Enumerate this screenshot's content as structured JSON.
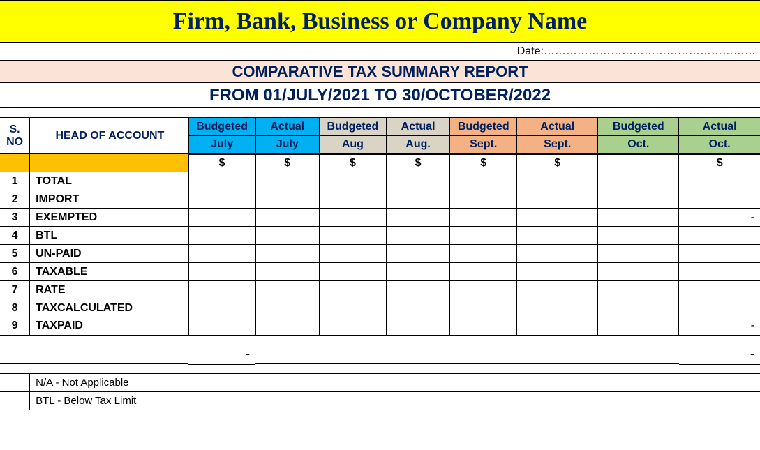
{
  "title": "Firm, Bank, Business or Company  Name",
  "date_label": "Date:…………………………………………………",
  "report_title": "COMPARATIVE TAX  SUMMARY REPORT",
  "period": "FROM 01/JULY/2021  TO 30/OCTOBER/2022",
  "headers": {
    "sno": "S. NO",
    "hoa": "HEAD OF ACCOUNT",
    "cols": [
      {
        "top": "Budgeted",
        "bot": "July"
      },
      {
        "top": "Actual",
        "bot": "July"
      },
      {
        "top": "Budgeted",
        "bot": "Aug"
      },
      {
        "top": "Actual",
        "bot": "Aug."
      },
      {
        "top": "Budgeted",
        "bot": "Sept."
      },
      {
        "top": "Actual",
        "bot": "Sept."
      },
      {
        "top": "Budgeted",
        "bot": "Oct."
      },
      {
        "top": "Actual",
        "bot": "Oct."
      }
    ]
  },
  "currency": "$",
  "rows": [
    {
      "n": "1",
      "label": " TOTAL",
      "vals": [
        "",
        "",
        "",
        "",
        "",
        "",
        "",
        ""
      ]
    },
    {
      "n": "2",
      "label": "IMPORT",
      "vals": [
        "",
        "",
        "",
        "",
        "",
        "",
        "",
        ""
      ]
    },
    {
      "n": "3",
      "label": "EXEMPTED",
      "vals": [
        "",
        "",
        "",
        "",
        "",
        "",
        "",
        "-"
      ]
    },
    {
      "n": "4",
      "label": "BTL",
      "vals": [
        "",
        "",
        "",
        "",
        "",
        "",
        "",
        ""
      ]
    },
    {
      "n": "5",
      "label": "UN-PAID",
      "vals": [
        "",
        "",
        "",
        "",
        "",
        "",
        "",
        ""
      ]
    },
    {
      "n": "6",
      "label": "TAXABLE",
      "vals": [
        "",
        "",
        "",
        "",
        "",
        "",
        "",
        ""
      ]
    },
    {
      "n": "7",
      "label": "RATE",
      "vals": [
        "",
        "",
        "",
        "",
        "",
        "",
        "",
        ""
      ]
    },
    {
      "n": "8",
      "label": "TAXCALCULATED",
      "vals": [
        "",
        "",
        "",
        "",
        "",
        "",
        "",
        ""
      ]
    },
    {
      "n": "9",
      "label": "TAXPAID",
      "vals": [
        "",
        "",
        "",
        "",
        "",
        "",
        "",
        "-"
      ]
    }
  ],
  "totals": [
    "-",
    "",
    "",
    "",
    "",
    "",
    "",
    "-"
  ],
  "legend1": "N/A - Not Applicable",
  "legend2": "BTL - Below Tax Limit"
}
